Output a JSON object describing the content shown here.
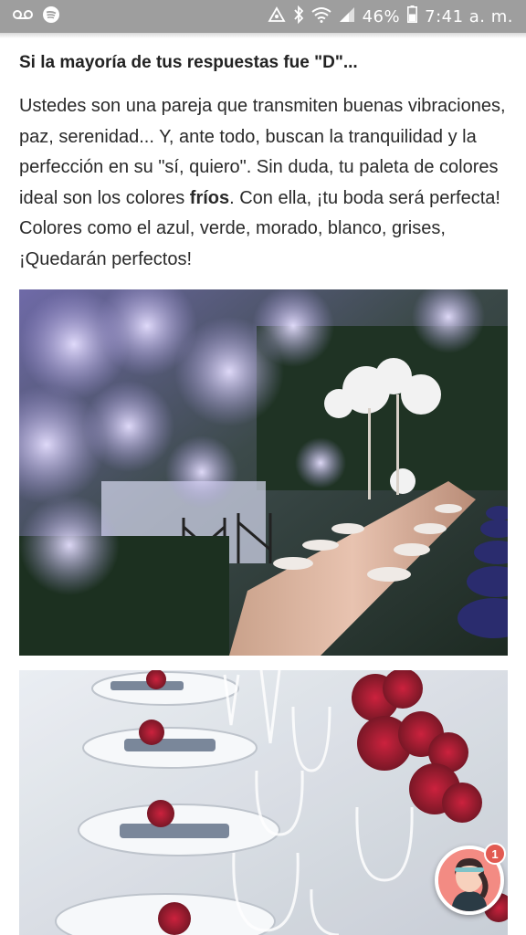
{
  "status_bar": {
    "battery_percent": "46%",
    "time": "7:41 a. m.",
    "icons": [
      "voicemail-icon",
      "spotify-icon",
      "sync-icon",
      "bluetooth-icon",
      "wifi-icon",
      "signal-icon",
      "battery-icon"
    ]
  },
  "article": {
    "heading": "Si la mayoría de tus respuestas fue \"D\"...",
    "paragraph_before_bold": "Ustedes son una pareja que transmiten buenas vibraciones, paz, serenidad... Y, ante todo, buscan la tranquilidad y la perfección en su \"sí, quiero\". Sin duda, tu paleta de colores ideal son los colores ",
    "paragraph_bold": "fríos",
    "paragraph_after_bold": ". Con ella, ¡tu boda será perfecta! Colores como el azul, verde, morado, blanco, grises, ¡Quedarán perfectos!"
  },
  "chat_button": {
    "badge_count": "1"
  },
  "colors": {
    "status_bar": "#9e9e9e",
    "badge": "#e25a52",
    "avatar_bg": "#f38b83"
  }
}
